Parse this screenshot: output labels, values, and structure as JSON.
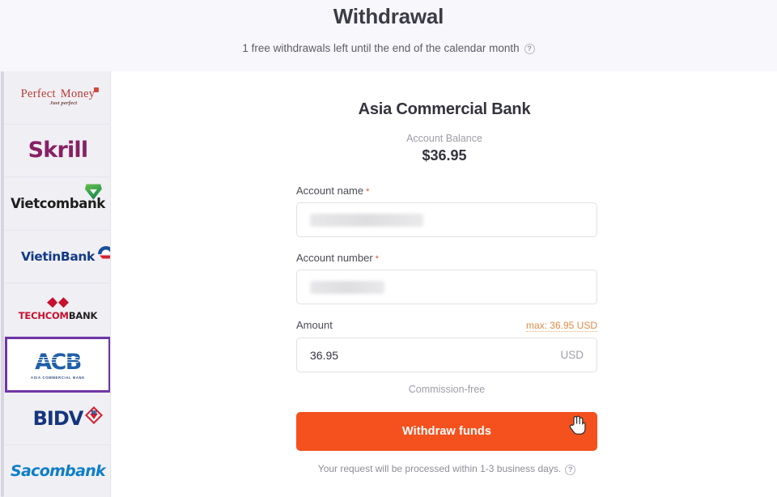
{
  "header": {
    "title": "Withdrawal",
    "subtitle": "1 free withdrawals left until the end of the calendar month",
    "info_icon": "question-circle-icon"
  },
  "sidebar": {
    "banks": [
      {
        "id": "perfect-money",
        "name": "Perfect Money",
        "tagline": "Just perfect",
        "selected": false
      },
      {
        "id": "skrill",
        "name": "Skrill",
        "selected": false
      },
      {
        "id": "vietcombank",
        "name": "Vietcombank",
        "selected": false
      },
      {
        "id": "vietinbank",
        "name": "VietinBank",
        "selected": false
      },
      {
        "id": "techcombank",
        "name_red": "TECHCOM",
        "name_dark": "BANK",
        "selected": false
      },
      {
        "id": "acb",
        "name": "ACB",
        "subtitle": "ASIA COMMERCIAL BANK",
        "selected": true
      },
      {
        "id": "bidv",
        "name": "BIDV",
        "selected": false
      },
      {
        "id": "sacombank",
        "name": "Sacombank",
        "selected": false
      }
    ],
    "selected_border_color": "#6f35a5"
  },
  "main": {
    "bank_title": "Asia Commercial Bank",
    "balance_label": "Account Balance",
    "balance_value": "$36.95",
    "fields": {
      "account_name": {
        "label": "Account name",
        "required_mark": "*",
        "value": ""
      },
      "account_number": {
        "label": "Account number",
        "required_mark": "*",
        "value": ""
      },
      "amount": {
        "label": "Amount",
        "max_link": "max: 36.95 USD",
        "value": "36.95",
        "currency": "USD"
      }
    },
    "commission": "Commission-free",
    "submit_label": "Withdraw funds",
    "submit_color": "#f4511e",
    "note": "Your request will be processed within 1-3 business days.",
    "note_icon": "question-circle-icon"
  }
}
